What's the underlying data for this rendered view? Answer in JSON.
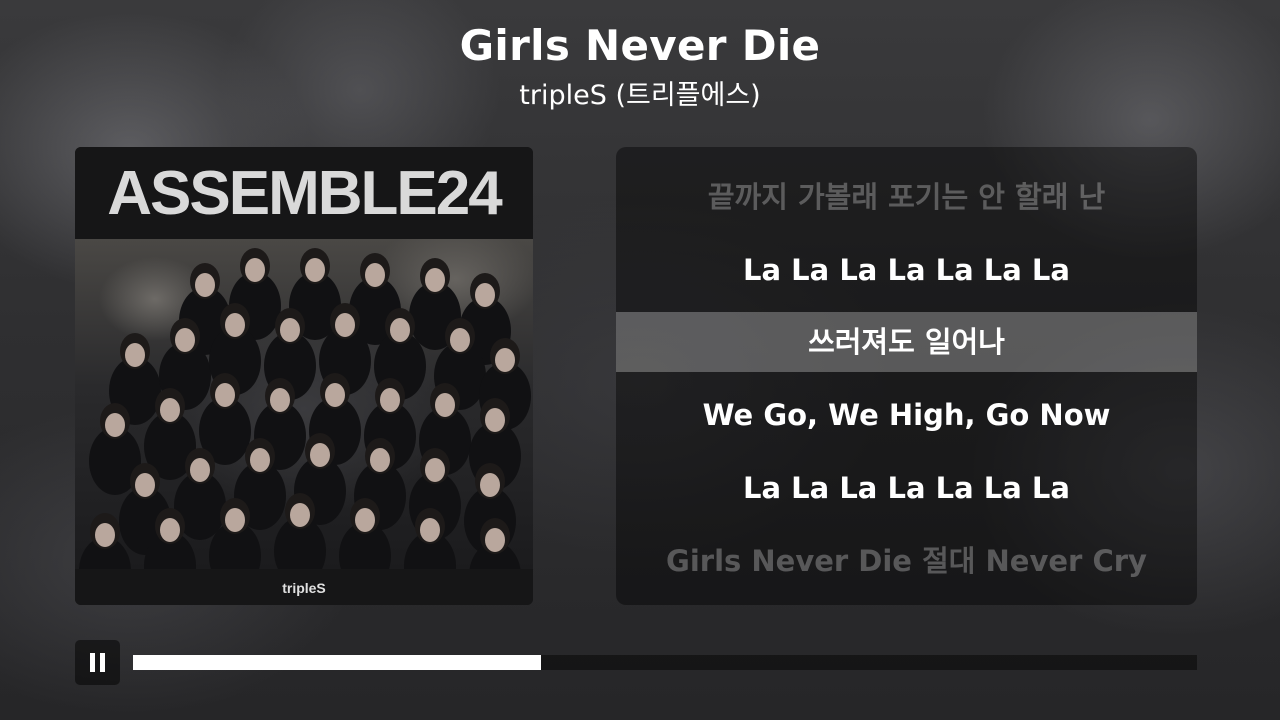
{
  "song": {
    "title": "Girls Never Die",
    "artist": "tripleS (트리플에스)"
  },
  "album_cover": {
    "title": "ASSEMBLE24",
    "brand": "tripleS"
  },
  "lyrics": [
    {
      "text": "끝까지 가볼래 포기는 안 할래 난",
      "state": "dim"
    },
    {
      "text": "La La La La La La La",
      "state": "normal"
    },
    {
      "text": "쓰러져도 일어나",
      "state": "current"
    },
    {
      "text": "We Go, We High, Go Now",
      "state": "normal"
    },
    {
      "text": "La La La La La La La",
      "state": "normal"
    },
    {
      "text": "Girls Never Die 절대 Never Cry",
      "state": "dim"
    }
  ],
  "player": {
    "button_icon": "pause-icon",
    "progress_fraction": 0.383
  },
  "colors": {
    "text": "#ffffff",
    "progress_fill": "#ffffff",
    "highlight": "rgba(255,255,255,0.28)"
  }
}
